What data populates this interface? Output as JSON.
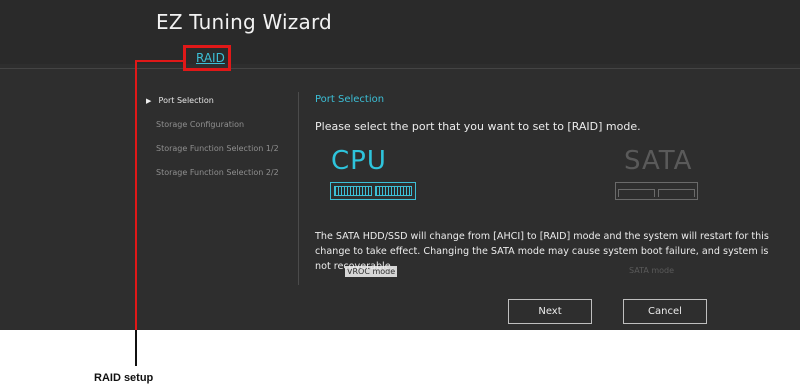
{
  "window": {
    "title": "EZ Tuning Wizard",
    "tab": "RAID"
  },
  "sidebar": {
    "items": [
      {
        "label": "Port Selection",
        "active": true
      },
      {
        "label": "Storage Configuration",
        "active": false
      },
      {
        "label": "Storage Function Selection 1/2",
        "active": false
      },
      {
        "label": "Storage Function Selection 2/2",
        "active": false
      }
    ]
  },
  "main": {
    "section_title": "Port Selection",
    "instruction": "Please select the port that you want to set to [RAID] mode.",
    "options": [
      {
        "big_label": "CPU",
        "mode_label": "VROC mode",
        "selected": true,
        "icon": "port-connector-icon"
      },
      {
        "big_label": "SATA",
        "mode_label": "SATA mode",
        "selected": false,
        "icon": "port-connector-icon"
      }
    ],
    "warning": "The SATA HDD/SSD will change from [AHCI] to [RAID] mode and the system will restart for this change to take effect. Changing the SATA mode may cause system boot failure, and system is not recoverable."
  },
  "buttons": {
    "next": "Next",
    "cancel": "Cancel"
  },
  "annotation": {
    "caption": "RAID setup"
  },
  "colors": {
    "accent": "#3cbfd6",
    "highlight": "#e01818",
    "panel_bg": "#2e2e2e"
  }
}
